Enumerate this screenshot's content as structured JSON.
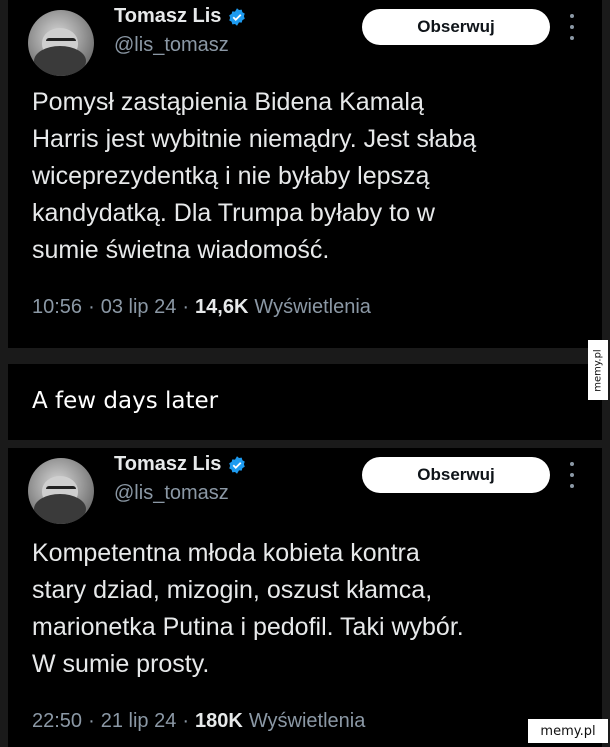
{
  "tweets": [
    {
      "author_name": "Tomasz Lis",
      "handle": "@lis_tomasz",
      "follow_label": "Obserwuj",
      "text": "Pomysł zastąpienia Bidena Kamalą\nHarris jest wybitnie niemądry. Jest słabą\nwiceprezydentką i nie byłaby lepszą\nkandydatką. Dla Trumpa  byłaby to w\nsumie świetna wiadomość.",
      "time": "10:56",
      "date": "03 lip 24",
      "views_count": "14,6K",
      "views_label": "Wyświetlenia"
    },
    {
      "author_name": "Tomasz Lis",
      "handle": "@lis_tomasz",
      "follow_label": "Obserwuj",
      "text": "Kompetentna młoda kobieta kontra\nstary dziad, mizogin, oszust  kłamca,\nmarionetka Putina i pedofil. Taki wybór.\nW sumie prosty.",
      "time": "22:50",
      "date": "21 lip 24",
      "views_count": "180K",
      "views_label": "Wyświetlenia"
    }
  ],
  "banner": {
    "text": "A few days later"
  },
  "watermarks": {
    "side": "memy.pl",
    "corner": "memy.pl"
  },
  "colors": {
    "background": "#000000",
    "text_primary": "#e7e9ea",
    "text_secondary": "#8b98a5",
    "verified_badge": "#1d9bf0",
    "follow_button_bg": "#ffffff"
  },
  "icons": {
    "verified": "verified-badge-icon",
    "more": "more-options-icon"
  }
}
